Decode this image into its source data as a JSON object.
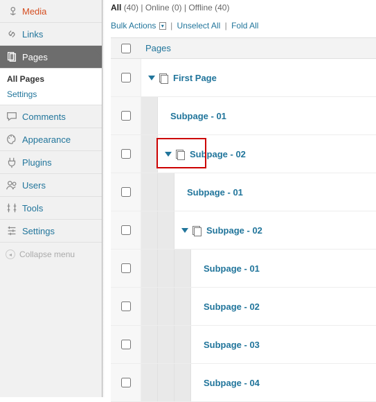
{
  "sidebar": {
    "items": [
      {
        "label": "Media",
        "icon": "media-icon"
      },
      {
        "label": "Links",
        "icon": "links-icon"
      },
      {
        "label": "Pages",
        "icon": "pages-icon",
        "active": true
      },
      {
        "label": "Comments",
        "icon": "comments-icon"
      },
      {
        "label": "Appearance",
        "icon": "appearance-icon"
      },
      {
        "label": "Plugins",
        "icon": "plugins-icon"
      },
      {
        "label": "Users",
        "icon": "users-icon"
      },
      {
        "label": "Tools",
        "icon": "tools-icon"
      },
      {
        "label": "Settings",
        "icon": "settings-icon"
      }
    ],
    "submenu": {
      "items": [
        {
          "label": "All Pages",
          "current": true
        },
        {
          "label": "Settings"
        }
      ]
    },
    "collapse": "Collapse menu"
  },
  "filter": {
    "all_label": "All",
    "all_count": "(40)",
    "online_label": "Online",
    "online_count": "(0)",
    "offline_label": "Offline",
    "offline_count": "(40)"
  },
  "actions": {
    "bulk": "Bulk Actions",
    "unselect": "Unselect All",
    "fold": "Fold All"
  },
  "table": {
    "header": "Pages",
    "rows": [
      {
        "depth": 0,
        "hasChildren": true,
        "title": "First Page"
      },
      {
        "depth": 1,
        "hasChildren": false,
        "title": "Subpage - 01"
      },
      {
        "depth": 1,
        "hasChildren": true,
        "title": "Subpage - 02",
        "highlight": true
      },
      {
        "depth": 2,
        "hasChildren": false,
        "title": "Subpage - 01"
      },
      {
        "depth": 2,
        "hasChildren": true,
        "title": "Subpage - 02"
      },
      {
        "depth": 3,
        "hasChildren": false,
        "title": "Subpage - 01"
      },
      {
        "depth": 3,
        "hasChildren": false,
        "title": "Subpage - 02"
      },
      {
        "depth": 3,
        "hasChildren": false,
        "title": "Subpage - 03"
      },
      {
        "depth": 3,
        "hasChildren": false,
        "title": "Subpage - 04"
      }
    ]
  }
}
